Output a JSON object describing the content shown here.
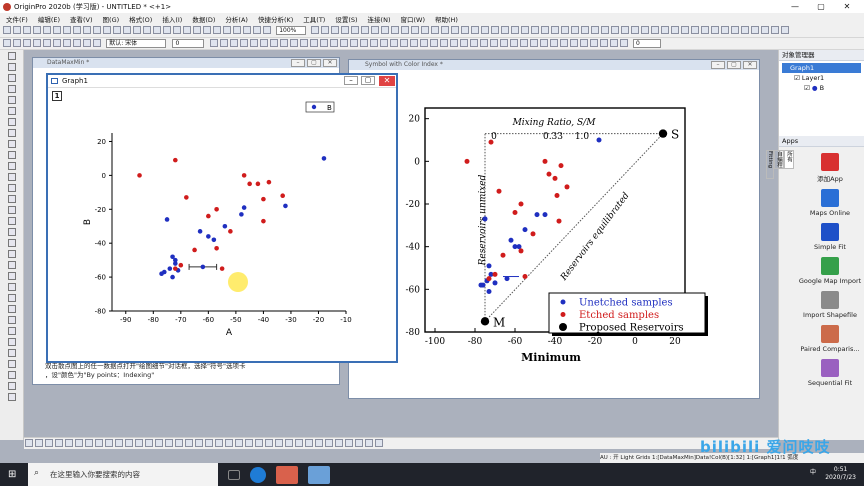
{
  "window": {
    "title": "OriginPro 2020b (学习版) - UNTITLED * <+1>"
  },
  "menu": [
    "文件(F)",
    "编辑(E)",
    "查看(V)",
    "图(G)",
    "格式(O)",
    "插入(I)",
    "数据(D)",
    "分析(A)",
    "快捷分析(K)",
    "工具(T)",
    "设置(S)",
    "连接(N)",
    "窗口(W)",
    "帮助(H)"
  ],
  "toolbar": {
    "zoom": "100%",
    "font_name": "默认: 宋体",
    "font_size": "0",
    "size2": "0"
  },
  "windows": {
    "datamaxmin": "DataMaxMin *",
    "graph1": "Graph1",
    "symbol": "Symbol with Color Index *",
    "layer_tab": "1"
  },
  "note_text": {
    "line1": "双击散点图上的任一数据点打开\"绘图细节\"对话框，选择\"符号\"选项卡",
    "line2": "，设\"颜色\"为\"By points：Indexing\""
  },
  "graph1_chart": {
    "chart_data": {
      "type": "scatter",
      "xlabel": "A",
      "ylabel": "B",
      "xlim": [
        -95,
        -10
      ],
      "ylim": [
        -80,
        25
      ],
      "xticks": [
        -90,
        -80,
        -70,
        -60,
        -50,
        -40,
        -30,
        -20,
        -10
      ],
      "yticks": [
        20,
        0,
        -20,
        -40,
        -60,
        -80
      ],
      "legend": {
        "label": "B",
        "position": "top-right"
      },
      "series": [
        {
          "name": "B",
          "color": "#1f2fc0",
          "points": [
            [
              -75,
              -26
            ],
            [
              -73,
              -48
            ],
            [
              -72,
              -52
            ],
            [
              -74,
              -55
            ],
            [
              -76,
              -57
            ],
            [
              -73,
              -60
            ],
            [
              -71,
              -56
            ],
            [
              -72,
              -50
            ],
            [
              -63,
              -33
            ],
            [
              -60,
              -36
            ],
            [
              -58,
              -38
            ],
            [
              -62,
              -54
            ],
            [
              -54,
              -30
            ],
            [
              -48,
              -23
            ],
            [
              -47,
              -19
            ],
            [
              -32,
              -18
            ],
            [
              -18,
              10
            ],
            [
              -77,
              -58
            ]
          ]
        },
        {
          "name": "",
          "color": "#d01c1c",
          "points": [
            [
              -85,
              0
            ],
            [
              -72,
              9
            ],
            [
              -68,
              -13
            ],
            [
              -65,
              -44
            ],
            [
              -60,
              -24
            ],
            [
              -57,
              -20
            ],
            [
              -57,
              -43
            ],
            [
              -55,
              -55
            ],
            [
              -52,
              -33
            ],
            [
              -47,
              0
            ],
            [
              -45,
              -5
            ],
            [
              -42,
              -5
            ],
            [
              -40,
              -14
            ],
            [
              -40,
              -27
            ],
            [
              -38,
              -4
            ],
            [
              -33,
              -12
            ],
            [
              -70,
              -53
            ],
            [
              -72,
              -55
            ]
          ]
        }
      ],
      "error_bar": {
        "x": -62,
        "y": -54,
        "xerr": 5
      }
    }
  },
  "symbol_chart": {
    "chart_data": {
      "type": "scatter",
      "xlabel": "Minimum",
      "xlim": [
        -105,
        25
      ],
      "ylim": [
        -80,
        25
      ],
      "xticks": [
        -100,
        -80,
        -60,
        -40,
        -20,
        0,
        20
      ],
      "yticks": [
        20,
        0,
        -20,
        -40,
        -60,
        -80
      ],
      "top_axis": {
        "title": "Mixing Ratio, S/M",
        "ticks": [
          "0",
          "0.33",
          "1.0"
        ]
      },
      "legend": {
        "position": "bottom-right",
        "entries": [
          {
            "label": "Unetched samples",
            "color": "#1f2fc0"
          },
          {
            "label": "Etched samples",
            "color": "#d01c1c"
          },
          {
            "label": "Proposed Reservoirs",
            "color": "#000000"
          }
        ]
      },
      "points_blue": [
        [
          -75,
          -27
        ],
        [
          -73,
          -49
        ],
        [
          -72,
          -53
        ],
        [
          -74,
          -56
        ],
        [
          -76,
          -58
        ],
        [
          -73,
          -61
        ],
        [
          -70,
          -57
        ],
        [
          -62,
          -37
        ],
        [
          -60,
          -40
        ],
        [
          -58,
          -40
        ],
        [
          -64,
          -55
        ],
        [
          -55,
          -32
        ],
        [
          -49,
          -25
        ],
        [
          -45,
          -25
        ],
        [
          -18,
          10
        ],
        [
          -77,
          -58
        ]
      ],
      "points_red": [
        [
          -84,
          0
        ],
        [
          -72,
          9
        ],
        [
          -68,
          -14
        ],
        [
          -66,
          -44
        ],
        [
          -60,
          -24
        ],
        [
          -57,
          -20
        ],
        [
          -57,
          -42
        ],
        [
          -55,
          -54
        ],
        [
          -51,
          -34
        ],
        [
          -45,
          0
        ],
        [
          -43,
          -6
        ],
        [
          -40,
          -8
        ],
        [
          -39,
          -16
        ],
        [
          -38,
          -28
        ],
        [
          -37,
          -2
        ],
        [
          -34,
          -12
        ],
        [
          -70,
          -53
        ],
        [
          -73,
          -55
        ]
      ],
      "reservoirs": [
        {
          "label": "S",
          "x": 14,
          "y": 13
        },
        {
          "label": "M",
          "x": -75,
          "y": -75
        }
      ],
      "annotations": [
        "Reservoirs unmixed",
        "Reservoirs equilibrated"
      ]
    }
  },
  "right_panel": {
    "header1": "对象管理器",
    "tree": [
      "Graph1",
      "Layer1",
      "B"
    ],
    "header2": "Apps",
    "tabs": [
      "所有",
      "自编程",
      "Fitting"
    ],
    "apps": [
      {
        "label": "添加App",
        "color": "#d83030"
      },
      {
        "label": "Maps Online",
        "color": "#2a6fd6"
      },
      {
        "label": "Simple Fit",
        "color": "#1e50c8"
      },
      {
        "label": "Google Map Import",
        "color": "#35a04a"
      },
      {
        "label": "Import Shapefile",
        "color": "#8a8a8a"
      },
      {
        "label": "Paired Comparis...",
        "color": "#cc6b4a"
      },
      {
        "label": "Sequential Fit",
        "color": "#9a60c0"
      }
    ]
  },
  "statusbar": {
    "text": "AU : 开  Light Grids 1:[DataMaxMin]Data!Col(B)[1:32]  1:[Graph1]1!1 弧度"
  },
  "taskbar": {
    "search_placeholder": "在这里输入你要搜索的内容",
    "time": "0:51",
    "date": "2020/7/23",
    "ime": "中"
  },
  "watermark": "bilibili 爱问吱吱"
}
